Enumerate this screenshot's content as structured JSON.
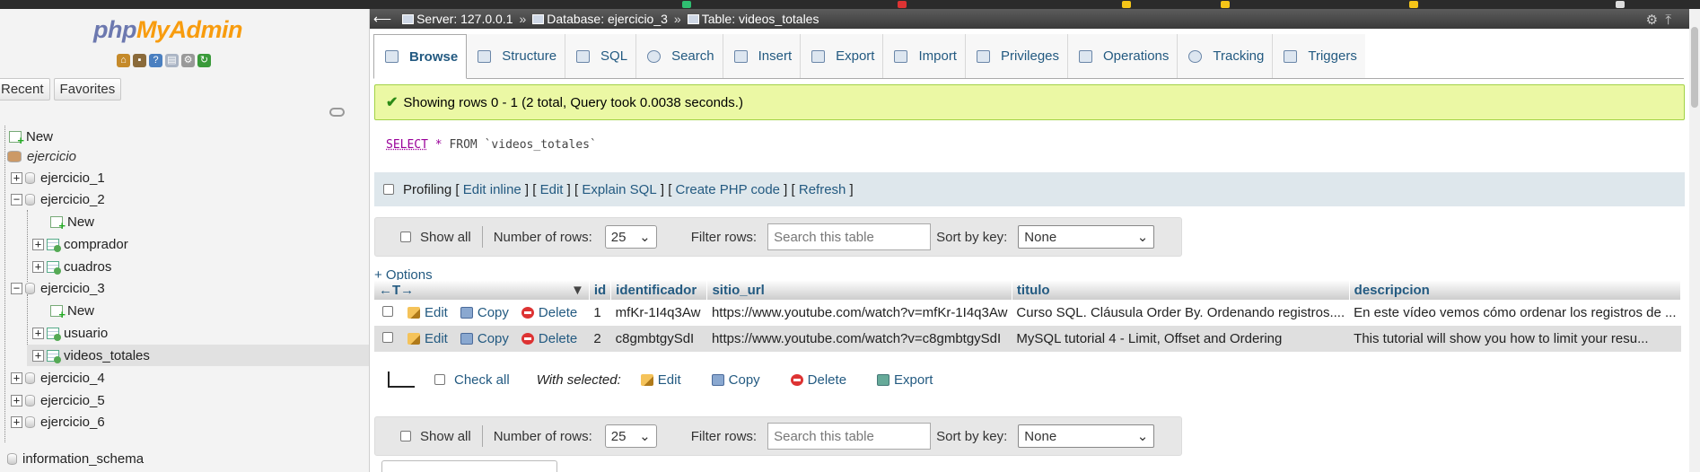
{
  "app": {
    "logo_left": "php",
    "logo_right": "MyAdmin"
  },
  "left_panel": {
    "tabs": [
      "Recent",
      "Favorites"
    ],
    "tree": [
      {
        "label": "New",
        "kind": "new"
      },
      {
        "label": "ejercicio",
        "kind": "db-italic"
      },
      {
        "label": "ejercicio_1",
        "kind": "db"
      },
      {
        "label": "ejercicio_2",
        "kind": "db"
      },
      {
        "label": "New",
        "kind": "new"
      },
      {
        "label": "comprador",
        "kind": "table"
      },
      {
        "label": "cuadros",
        "kind": "table"
      },
      {
        "label": "ejercicio_3",
        "kind": "db"
      },
      {
        "label": "New",
        "kind": "new"
      },
      {
        "label": "usuario",
        "kind": "table"
      },
      {
        "label": "videos_totales",
        "kind": "table"
      },
      {
        "label": "ejercicio_4",
        "kind": "db"
      },
      {
        "label": "ejercicio_5",
        "kind": "db"
      },
      {
        "label": "ejercicio_6",
        "kind": "db"
      },
      {
        "label": "information_schema",
        "kind": "db"
      }
    ]
  },
  "breadcrumb": {
    "server": "Server: 127.0.0.1",
    "database": "Database: ejercicio_3",
    "table": "Table: videos_totales"
  },
  "tabs": [
    "Browse",
    "Structure",
    "SQL",
    "Search",
    "Insert",
    "Export",
    "Import",
    "Privileges",
    "Operations",
    "Tracking",
    "Triggers"
  ],
  "active_tab": "Browse",
  "message": "Showing rows 0 - 1 (2 total, Query took 0.0038 seconds.)",
  "sql": {
    "select": "SELECT",
    "star": "*",
    "from": "FROM",
    "table": "`videos_totales`"
  },
  "profiling": {
    "label": "Profiling",
    "links": [
      "Edit inline",
      "Edit",
      "Explain SQL",
      "Create PHP code",
      "Refresh"
    ]
  },
  "nav": {
    "show_all": "Show all",
    "rows_label": "Number of rows:",
    "rows_value": "25",
    "filter_label": "Filter rows:",
    "filter_placeholder": "Search this table",
    "sort_label": "Sort by key:",
    "sort_value": "None"
  },
  "options_link": "+ Options",
  "table": {
    "columns": [
      "id",
      "identificador",
      "sitio_url",
      "titulo",
      "descripcion"
    ],
    "row_actions": [
      "Edit",
      "Copy",
      "Delete"
    ],
    "rows": [
      [
        "1",
        "mfKr-1I4q3Aw",
        "https://www.youtube.com/watch?v=mfKr-1I4q3Aw",
        "Curso SQL. Cláusula Order By. Ordenando registros....",
        "En este vídeo vemos cómo ordenar los registros de ..."
      ],
      [
        "2",
        "c8gmbtgySdI",
        "https://www.youtube.com/watch?v=c8gmbtgySdI",
        "MySQL tutorial 4 - Limit, Offset and Ordering",
        "This tutorial will show you how to limit your resu..."
      ]
    ]
  },
  "with_selected": {
    "check_all": "Check all",
    "label": "With selected:",
    "actions": [
      "Edit",
      "Copy",
      "Delete",
      "Export"
    ]
  }
}
